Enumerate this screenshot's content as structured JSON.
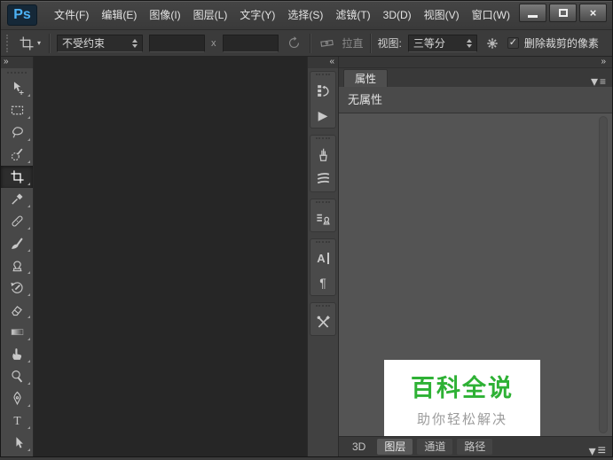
{
  "titlebar": {
    "logo": "Ps",
    "menus": [
      "文件(F)",
      "编辑(E)",
      "图像(I)",
      "图层(L)",
      "文字(Y)",
      "选择(S)",
      "滤镜(T)",
      "3D(D)",
      "视图(V)",
      "窗口(W)"
    ],
    "close_glyph": "×"
  },
  "options_bar": {
    "ratio_dropdown_value": "不受约束",
    "width_value": "",
    "x_separator": "x",
    "height_value": "",
    "straighten_label": "拉直",
    "view_label": "视图:",
    "view_dropdown_value": "三等分",
    "delete_pixels_label": "删除裁剪的像素",
    "delete_pixels_checked": true
  },
  "icons": {
    "expand_right": "»",
    "collapse_left": "«",
    "dropdown_caret": "▾",
    "check": "✓",
    "play": "▶",
    "paragraph": "¶",
    "character": "A",
    "menu_lines": "≡",
    "type_letter": "T"
  },
  "toolbar": {
    "tools": [
      {
        "name": "move"
      },
      {
        "name": "marquee"
      },
      {
        "name": "lasso"
      },
      {
        "name": "quick-selection"
      },
      {
        "name": "crop",
        "selected": true
      },
      {
        "name": "eyedropper"
      },
      {
        "name": "spot-healing"
      },
      {
        "name": "brush"
      },
      {
        "name": "clone-stamp"
      },
      {
        "name": "history-brush"
      },
      {
        "name": "eraser"
      },
      {
        "name": "gradient"
      },
      {
        "name": "smudge"
      },
      {
        "name": "dodge"
      },
      {
        "name": "pen"
      },
      {
        "name": "type"
      },
      {
        "name": "path-selection"
      }
    ]
  },
  "panel_strip": {
    "groups": [
      [
        "history",
        "actions-play"
      ],
      [
        "brush-panel",
        "brush-presets"
      ],
      [
        "clone-source"
      ],
      [
        "character",
        "paragraph"
      ],
      [
        "tool-presets"
      ]
    ]
  },
  "right_panel": {
    "tab_label": "属性",
    "no_properties_text": "无属性",
    "bottom_tabs": [
      {
        "label": "3D",
        "active": false
      },
      {
        "label": "图层",
        "active": true
      },
      {
        "label": "通道",
        "active": false
      },
      {
        "label": "路径",
        "active": false
      }
    ]
  },
  "watermark": {
    "title": "百科全说",
    "subtitle": "助你轻松解决",
    "title_color": "#2eb135"
  }
}
